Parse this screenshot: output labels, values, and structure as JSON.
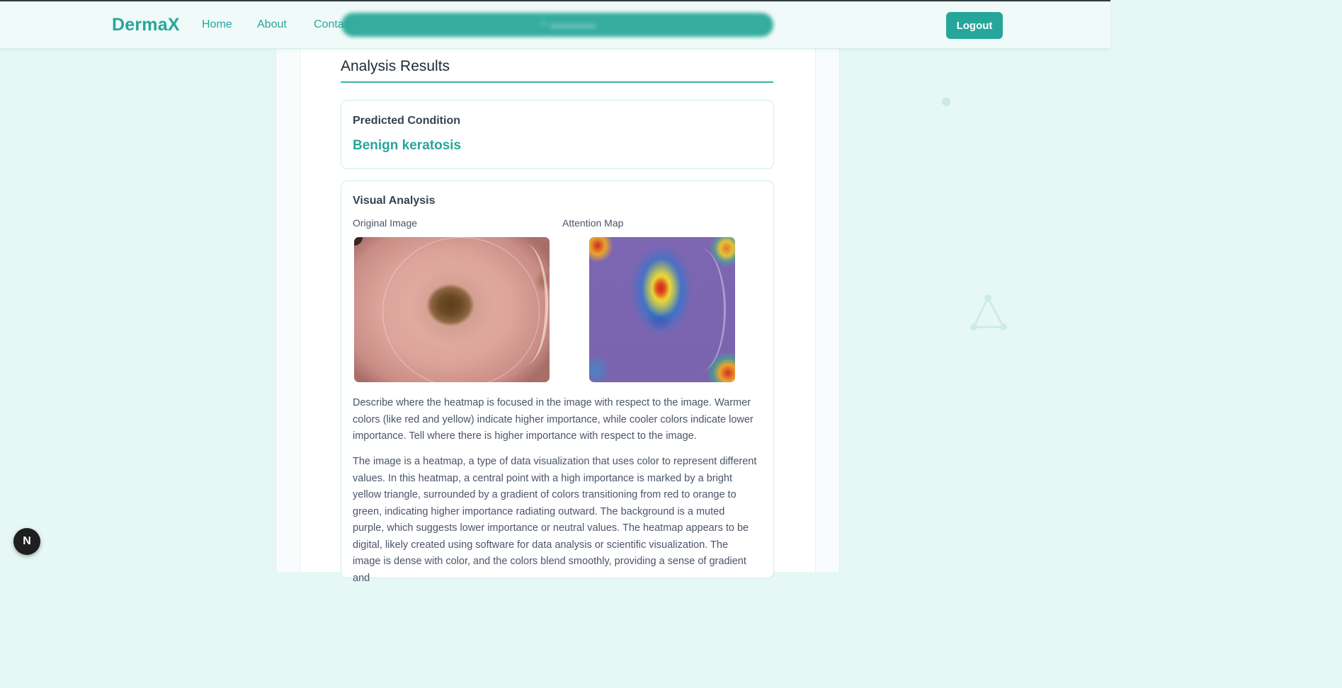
{
  "header": {
    "brand": "DermaX",
    "nav": [
      "Home",
      "About",
      "Contac"
    ],
    "logout_label": "Logout"
  },
  "results": {
    "title": "Analysis Results",
    "predicted": {
      "heading": "Predicted Condition",
      "value": "Benign keratosis"
    },
    "visual": {
      "heading": "Visual Analysis",
      "original_label": "Original Image",
      "attention_label": "Attention Map",
      "prompt_text": "Describe where the heatmap is focused in the image with respect to the image. Warmer colors (like red and yellow) indicate higher importance, while cooler colors indicate lower importance. Tell where there is higher importance with respect to the image.",
      "analysis_text": "The image is a heatmap, a type of data visualization that uses color to represent different values. In this heatmap, a central point with a high importance is marked by a bright yellow triangle, surrounded by a gradient of colors transitioning from red to orange to green, indicating higher importance radiating outward. The background is a muted purple, which suggests lower importance or neutral values. The heatmap appears to be digital, likely created using software for data analysis or scientific visualization. The image is dense with color, and the colors blend smoothly, providing a sense of gradient and"
    }
  },
  "badge": {
    "letter": "N"
  },
  "colors": {
    "accent": "#26a69a",
    "background": "#e6f8f5",
    "heading": "#1f2937",
    "body_text": "#4a5568"
  }
}
